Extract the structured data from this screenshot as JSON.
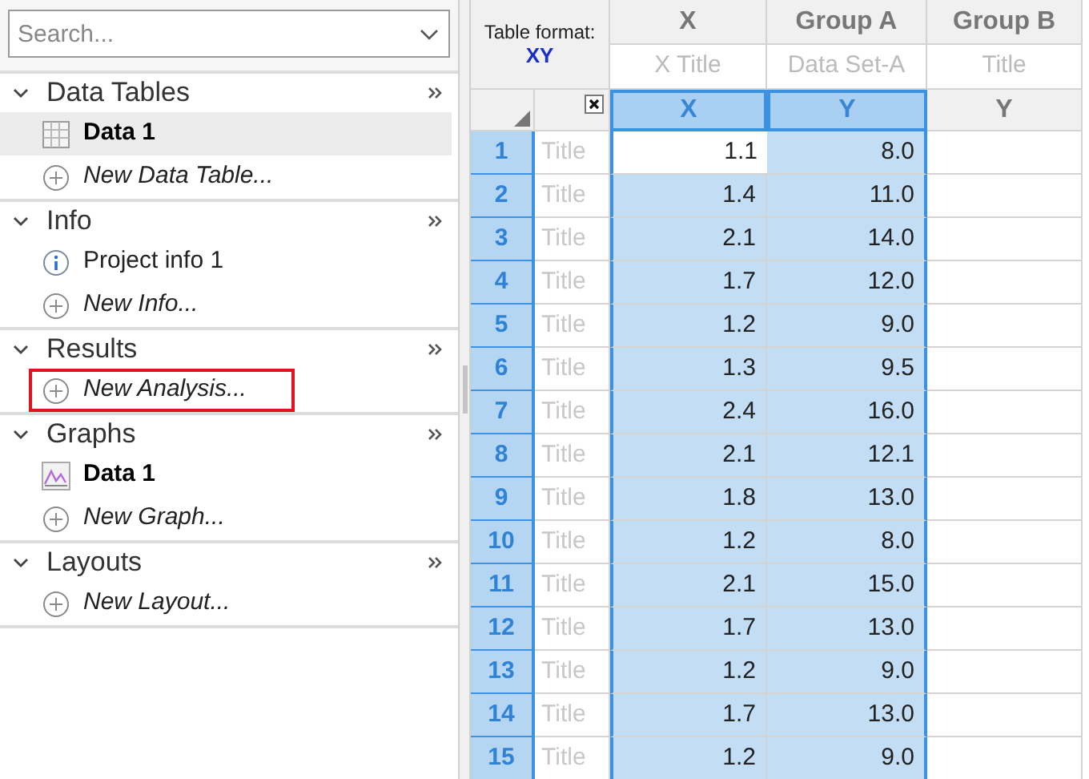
{
  "search": {
    "placeholder": "Search..."
  },
  "sections": [
    {
      "title": "Data Tables",
      "expanded": true,
      "items": [
        {
          "kind": "table",
          "label": "Data 1",
          "selected": true,
          "highlighted": false
        },
        {
          "kind": "new",
          "label": "New Data Table...",
          "selected": false,
          "highlighted": false
        }
      ]
    },
    {
      "title": "Info",
      "expanded": true,
      "items": [
        {
          "kind": "info",
          "label": "Project info 1",
          "selected": false,
          "highlighted": false
        },
        {
          "kind": "new",
          "label": "New Info...",
          "selected": false,
          "highlighted": false
        }
      ]
    },
    {
      "title": "Results",
      "expanded": true,
      "items": [
        {
          "kind": "new",
          "label": "New Analysis...",
          "selected": false,
          "highlighted": true
        }
      ]
    },
    {
      "title": "Graphs",
      "expanded": true,
      "items": [
        {
          "kind": "graph",
          "label": "Data 1",
          "selected": false,
          "highlighted": false
        },
        {
          "kind": "new",
          "label": "New Graph...",
          "selected": false,
          "highlighted": false
        }
      ]
    },
    {
      "title": "Layouts",
      "expanded": true,
      "items": [
        {
          "kind": "new",
          "label": "New Layout...",
          "selected": false,
          "highlighted": false
        }
      ]
    }
  ],
  "table": {
    "format_label": "Table format:",
    "format": "XY",
    "columns": [
      {
        "group": "X",
        "title": "X Title",
        "subcolumn": "X",
        "selected": true
      },
      {
        "group": "Group A",
        "title": "Data Set-A",
        "subcolumn": "Y",
        "selected": true
      },
      {
        "group": "Group B",
        "title": "Title",
        "subcolumn": "Y",
        "selected": false
      }
    ],
    "rows": [
      {
        "number": "1",
        "row_title": "Title",
        "active": true,
        "cells": [
          "1.1",
          "8.0"
        ]
      },
      {
        "number": "2",
        "row_title": "Title",
        "active": false,
        "cells": [
          "1.4",
          "11.0"
        ]
      },
      {
        "number": "3",
        "row_title": "Title",
        "active": false,
        "cells": [
          "2.1",
          "14.0"
        ]
      },
      {
        "number": "4",
        "row_title": "Title",
        "active": false,
        "cells": [
          "1.7",
          "12.0"
        ]
      },
      {
        "number": "5",
        "row_title": "Title",
        "active": false,
        "cells": [
          "1.2",
          "9.0"
        ]
      },
      {
        "number": "6",
        "row_title": "Title",
        "active": false,
        "cells": [
          "1.3",
          "9.5"
        ]
      },
      {
        "number": "7",
        "row_title": "Title",
        "active": false,
        "cells": [
          "2.4",
          "16.0"
        ]
      },
      {
        "number": "8",
        "row_title": "Title",
        "active": false,
        "cells": [
          "2.1",
          "12.1"
        ]
      },
      {
        "number": "9",
        "row_title": "Title",
        "active": false,
        "cells": [
          "1.8",
          "13.0"
        ]
      },
      {
        "number": "10",
        "row_title": "Title",
        "active": false,
        "cells": [
          "1.2",
          "8.0"
        ]
      },
      {
        "number": "11",
        "row_title": "Title",
        "active": false,
        "cells": [
          "2.1",
          "15.0"
        ]
      },
      {
        "number": "12",
        "row_title": "Title",
        "active": false,
        "cells": [
          "1.7",
          "13.0"
        ]
      },
      {
        "number": "13",
        "row_title": "Title",
        "active": false,
        "cells": [
          "1.2",
          "9.0"
        ]
      },
      {
        "number": "14",
        "row_title": "Title",
        "active": false,
        "cells": [
          "1.7",
          "13.0"
        ]
      },
      {
        "number": "15",
        "row_title": "Title",
        "active": false,
        "cells": [
          "1.2",
          "9.0"
        ]
      }
    ]
  }
}
